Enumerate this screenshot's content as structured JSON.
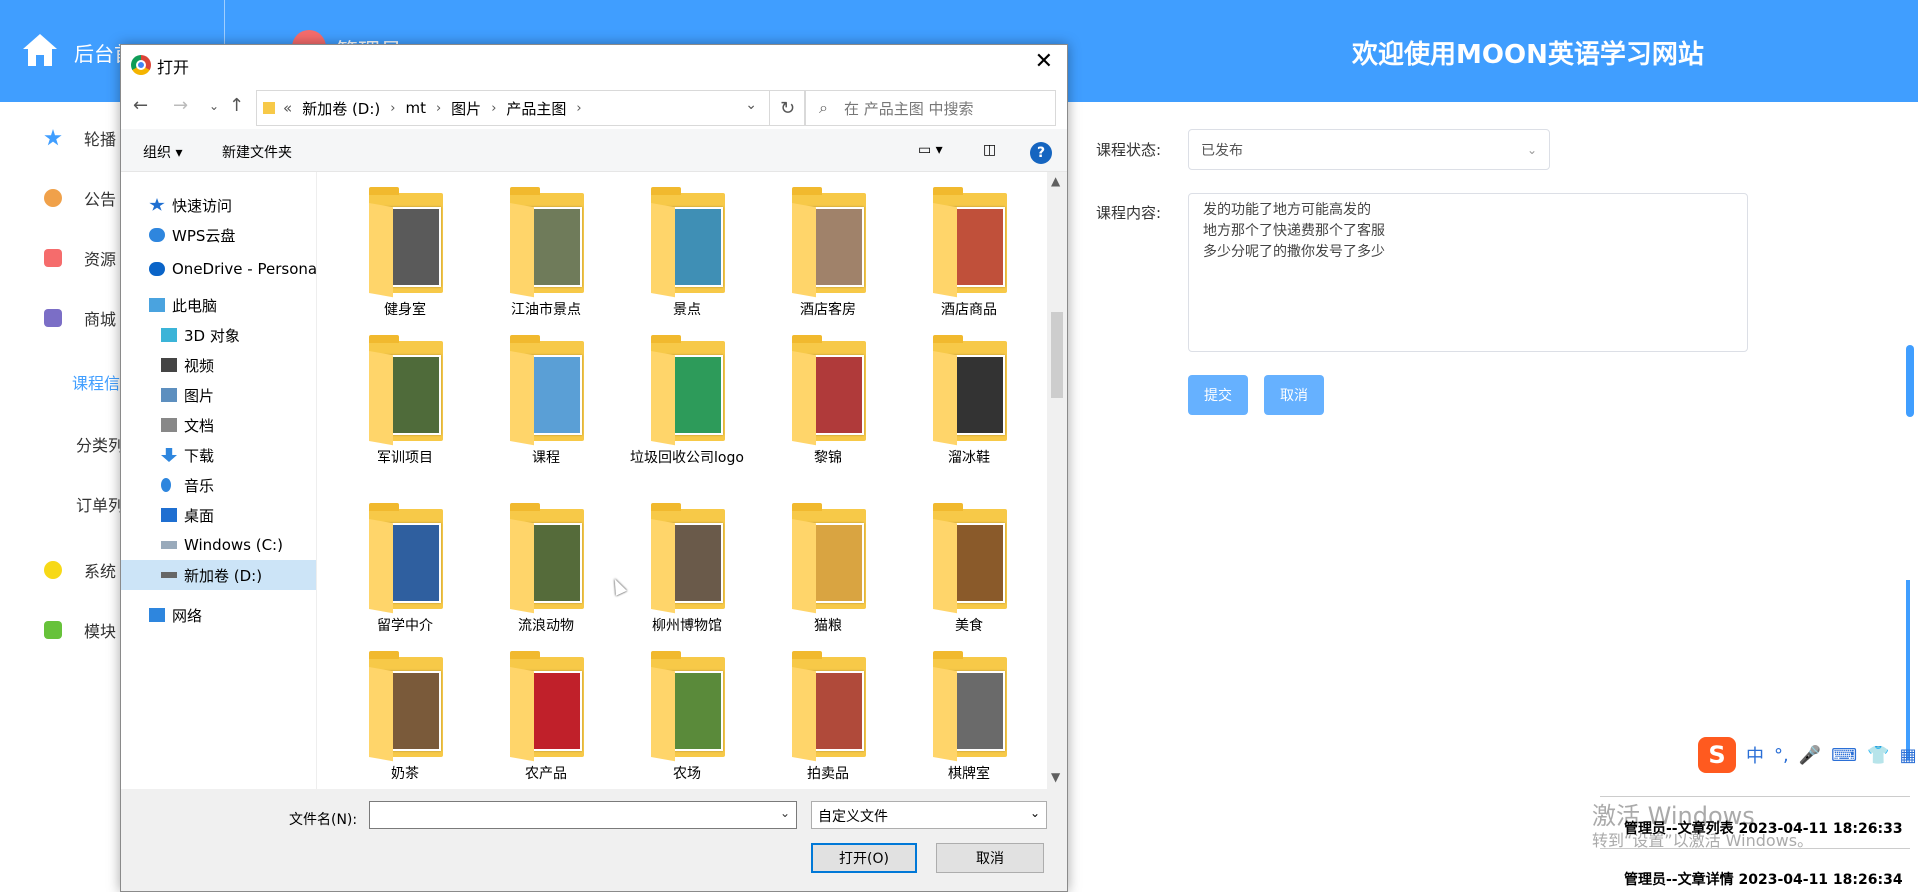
{
  "header": {
    "brand": "后台首",
    "role": "管理员",
    "welcome": "欢迎使用MOON英语学习网站"
  },
  "sidebar": {
    "items": [
      {
        "label": "轮播",
        "color": "#409eff"
      },
      {
        "label": "公告",
        "color": "#f0a14a"
      },
      {
        "label": "资源",
        "color": "#f56c6c"
      },
      {
        "label": "商城",
        "color": "#7b6ec6"
      }
    ],
    "sub_items": [
      "课程信",
      "分类列",
      "订单列"
    ],
    "items2": [
      {
        "label": "系统",
        "color": "#f7d917"
      },
      {
        "label": "模块",
        "color": "#67c23a"
      }
    ]
  },
  "form": {
    "status_label": "课程状态:",
    "status_value": "已发布",
    "content_label": "课程内容:",
    "content_value": "发的功能了地方可能高发的\n地方那个了快递费那个了客服\n多少分呢了的撒你发号了多少",
    "submit_label": "提交",
    "cancel_label": "取消"
  },
  "dialog": {
    "title": "打开",
    "close": "✕",
    "path": [
      "«",
      "新加卷 (D:)",
      "mt",
      "图片",
      "产品主图"
    ],
    "search_placeholder": "在 产品主图 中搜索",
    "organize": "组织 ▾",
    "new_folder": "新建文件夹",
    "help": "?",
    "nav_pane": [
      {
        "label": "快速访问",
        "icon": "star-icon"
      },
      {
        "label": "WPS云盘",
        "icon": "cloud-icon"
      },
      {
        "label": "OneDrive - Persona",
        "icon": "onedrive-icon"
      },
      {
        "label": "此电脑",
        "icon": "computer-icon"
      },
      {
        "label": "3D 对象",
        "icon": "cube-icon"
      },
      {
        "label": "视频",
        "icon": "video-icon"
      },
      {
        "label": "图片",
        "icon": "picture-icon"
      },
      {
        "label": "文档",
        "icon": "document-icon"
      },
      {
        "label": "下载",
        "icon": "download-icon"
      },
      {
        "label": "音乐",
        "icon": "music-icon"
      },
      {
        "label": "桌面",
        "icon": "desktop-icon"
      },
      {
        "label": "Windows (C:)",
        "icon": "drive-icon"
      },
      {
        "label": "新加卷 (D:)",
        "icon": "drive-icon"
      },
      {
        "label": "网络",
        "icon": "network-icon"
      }
    ],
    "folders": [
      {
        "label": "健身室",
        "color": "#5a5a5a"
      },
      {
        "label": "江油市景点",
        "color": "#6f7b5a"
      },
      {
        "label": "景点",
        "color": "#3f8fb5"
      },
      {
        "label": "酒店客房",
        "color": "#a0826a"
      },
      {
        "label": "酒店商品",
        "color": "#c0503a"
      },
      {
        "label": "军训项目",
        "color": "#4f6b3a"
      },
      {
        "label": "课程",
        "color": "#5a9fd6"
      },
      {
        "label": "垃圾回收公司logo",
        "color": "#2d9b5a"
      },
      {
        "label": "黎锦",
        "color": "#b03a3a"
      },
      {
        "label": "溜冰鞋",
        "color": "#333333"
      },
      {
        "label": "留学中介",
        "color": "#2f5f9f"
      },
      {
        "label": "流浪动物",
        "color": "#556b3a"
      },
      {
        "label": "柳州博物馆",
        "color": "#6a5a4a"
      },
      {
        "label": "猫粮",
        "color": "#d9a441"
      },
      {
        "label": "美食",
        "color": "#8a5a2a"
      },
      {
        "label": "奶茶",
        "color": "#7a5a3a"
      },
      {
        "label": "农产品",
        "color": "#c0202a"
      },
      {
        "label": "农场",
        "color": "#5a8a3a"
      },
      {
        "label": "拍卖品",
        "color": "#b04a3a"
      },
      {
        "label": "棋牌室",
        "color": "#6a6a6a"
      }
    ],
    "filename_label": "文件名(N):",
    "filetype": "自定义文件",
    "open_button": "打开(O)",
    "cancel_button": "取消"
  },
  "ime": {
    "logo": "S",
    "items": [
      "中",
      "°,",
      "🎤",
      "⌨",
      "👕",
      "▦"
    ]
  },
  "watermark": {
    "line1": "激活 Windows",
    "line2": "转到“设置”以激活 Windows。"
  },
  "logs": [
    "管理员--文章列表 2023-04-11 18:26:33",
    "管理员--文章详情 2023-04-11 18:26:34"
  ]
}
